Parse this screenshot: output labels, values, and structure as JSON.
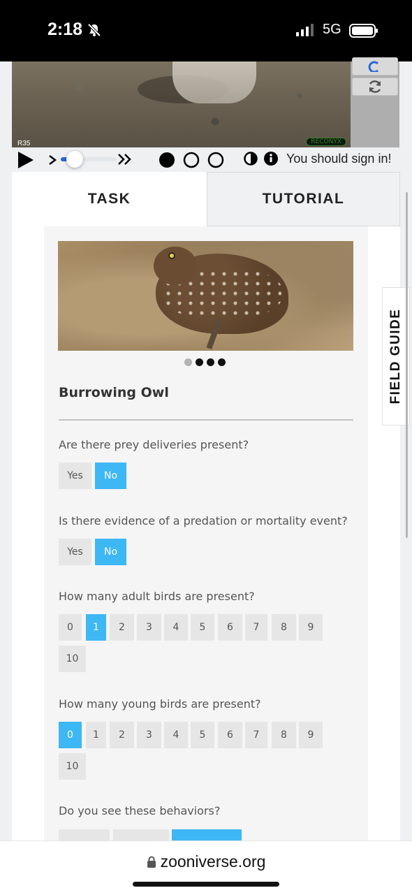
{
  "status_bar": {
    "time": "2:18",
    "network": "5G"
  },
  "camera": {
    "corner_label": "R35",
    "brand": "RECONYX"
  },
  "controls": {
    "sign_in_notice": "You should sign in!"
  },
  "tabs": {
    "task": "TASK",
    "tutorial": "TUTORIAL"
  },
  "field_guide_label": "FIELD GUIDE",
  "carousel": {
    "total": 4,
    "active": 1
  },
  "species": "Burrowing Owl",
  "questions": [
    {
      "text": "Are there prey deliveries present?",
      "options": [
        "Yes",
        "No"
      ],
      "selected": "No"
    },
    {
      "text": "Is there evidence of a predation or mortality event?",
      "options": [
        "Yes",
        "No"
      ],
      "selected": "No"
    },
    {
      "text": "How many adult birds are present?",
      "options": [
        "0",
        "1",
        "2",
        "3",
        "4",
        "5",
        "6",
        "7",
        "8",
        "9",
        "10"
      ],
      "selected": "1"
    },
    {
      "text": "How many young birds are present?",
      "options": [
        "0",
        "1",
        "2",
        "3",
        "4",
        "5",
        "6",
        "7",
        "8",
        "9",
        "10"
      ],
      "selected": "0"
    },
    {
      "text": "Do you see these behaviors?"
    }
  ],
  "browser": {
    "url": "zooniverse.org"
  },
  "colors": {
    "accent": "#3eb7f5",
    "option_bg": "#e6e6e6",
    "status_bar": "#000000"
  }
}
